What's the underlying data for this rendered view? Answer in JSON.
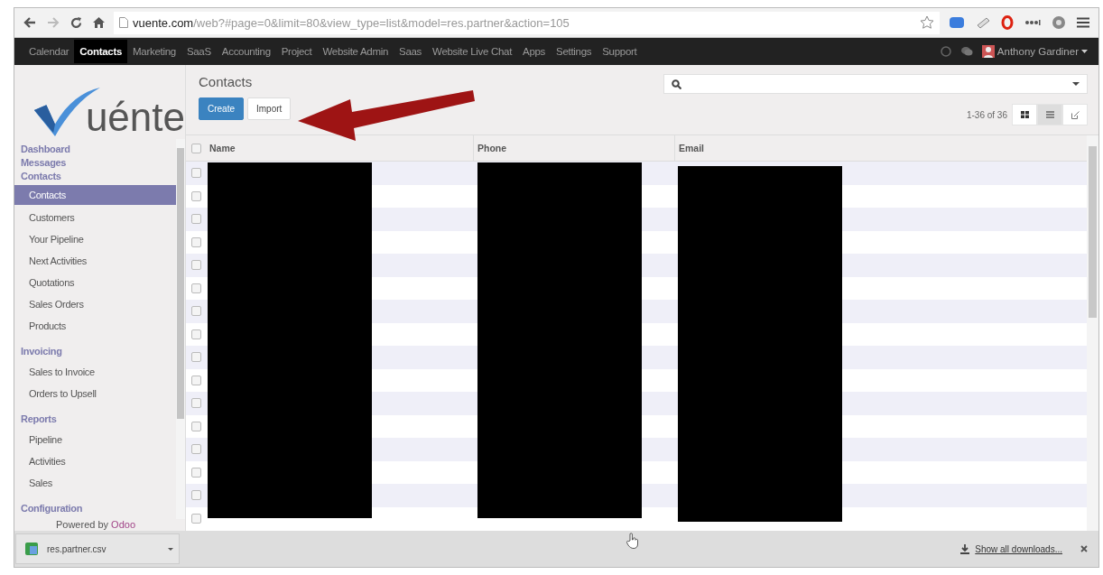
{
  "browser": {
    "url_host": "vuente.com",
    "url_path": "/web?#page=0&limit=80&view_type=list&model=res.partner&action=105"
  },
  "nav": [
    {
      "label": "Calendar",
      "selected": false
    },
    {
      "label": "Contacts",
      "selected": true
    },
    {
      "label": "Marketing",
      "selected": false
    },
    {
      "label": "SaaS",
      "selected": false
    },
    {
      "label": "Accounting",
      "selected": false
    },
    {
      "label": "Project",
      "selected": false
    },
    {
      "label": "Website Admin",
      "selected": false
    },
    {
      "label": "Saas",
      "selected": false
    },
    {
      "label": "Website Live Chat",
      "selected": false
    },
    {
      "label": "Apps",
      "selected": false
    },
    {
      "label": "Settings",
      "selected": false
    },
    {
      "label": "Support",
      "selected": false
    }
  ],
  "user": {
    "name": "Anthony Gardiner"
  },
  "logo": {
    "text": "uénte"
  },
  "sidebar": [
    {
      "kind": "heading",
      "label": "Dashboard"
    },
    {
      "kind": "heading",
      "label": "Messages"
    },
    {
      "kind": "heading",
      "label": "Contacts"
    },
    {
      "kind": "item",
      "label": "Contacts",
      "selected": true
    },
    {
      "kind": "item",
      "label": "Customers",
      "selected": false
    },
    {
      "kind": "item",
      "label": "Your Pipeline",
      "selected": false
    },
    {
      "kind": "item",
      "label": "Next Activities",
      "selected": false
    },
    {
      "kind": "item",
      "label": "Quotations",
      "selected": false
    },
    {
      "kind": "item",
      "label": "Sales Orders",
      "selected": false
    },
    {
      "kind": "item",
      "label": "Products",
      "selected": false
    },
    {
      "kind": "heading",
      "label": "Invoicing"
    },
    {
      "kind": "item",
      "label": "Sales to Invoice",
      "selected": false
    },
    {
      "kind": "item",
      "label": "Orders to Upsell",
      "selected": false
    },
    {
      "kind": "heading",
      "label": "Reports"
    },
    {
      "kind": "item",
      "label": "Pipeline",
      "selected": false
    },
    {
      "kind": "item",
      "label": "Activities",
      "selected": false
    },
    {
      "kind": "item",
      "label": "Sales",
      "selected": false
    },
    {
      "kind": "heading",
      "label": "Configuration"
    }
  ],
  "powered_by": {
    "text": "Powered by",
    "brand": "Odoo"
  },
  "page_title": "Contacts",
  "buttons": [
    {
      "label": "Create",
      "kind": "primary"
    },
    {
      "label": "Import",
      "kind": "default"
    }
  ],
  "pager": "1-36 of 36",
  "views": [
    {
      "kind": "kanban",
      "selected": false
    },
    {
      "kind": "list",
      "selected": true
    },
    {
      "kind": "form",
      "selected": false
    }
  ],
  "select_all": {
    "checked": false
  },
  "columns": [
    "Name",
    "Phone",
    "Email"
  ],
  "rows": [
    {
      "checked": false
    },
    {
      "checked": false
    },
    {
      "checked": false
    },
    {
      "checked": false
    },
    {
      "checked": false
    },
    {
      "checked": false
    },
    {
      "checked": false
    },
    {
      "checked": false
    },
    {
      "checked": false
    },
    {
      "checked": false
    },
    {
      "checked": false
    },
    {
      "checked": false
    },
    {
      "checked": false
    },
    {
      "checked": false
    },
    {
      "checked": false
    },
    {
      "checked": false
    }
  ],
  "downloads": {
    "file": "res.partner.csv",
    "show_all": "Show all downloads..."
  }
}
